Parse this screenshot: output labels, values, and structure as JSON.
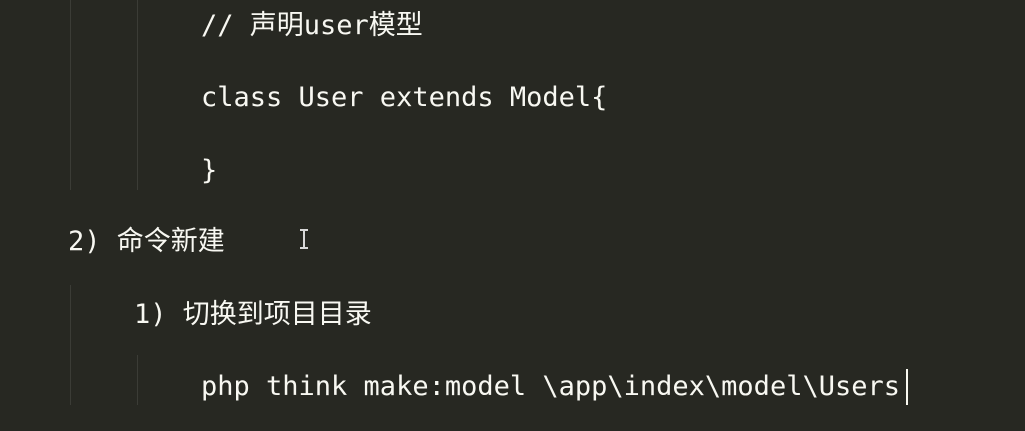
{
  "editor": {
    "colors": {
      "background": "#272822",
      "text": "#f8f8f2",
      "indent_guide": "#3b3c36"
    },
    "lines": [
      {
        "text": "// 声明user模型"
      },
      {
        "text": "class User extends Model{"
      },
      {
        "text": "}"
      },
      {
        "text": "2) 命令新建"
      },
      {
        "text": "1) 切换到项目目录"
      },
      {
        "text": "php think make:model \\app\\index\\model\\Users"
      }
    ]
  }
}
